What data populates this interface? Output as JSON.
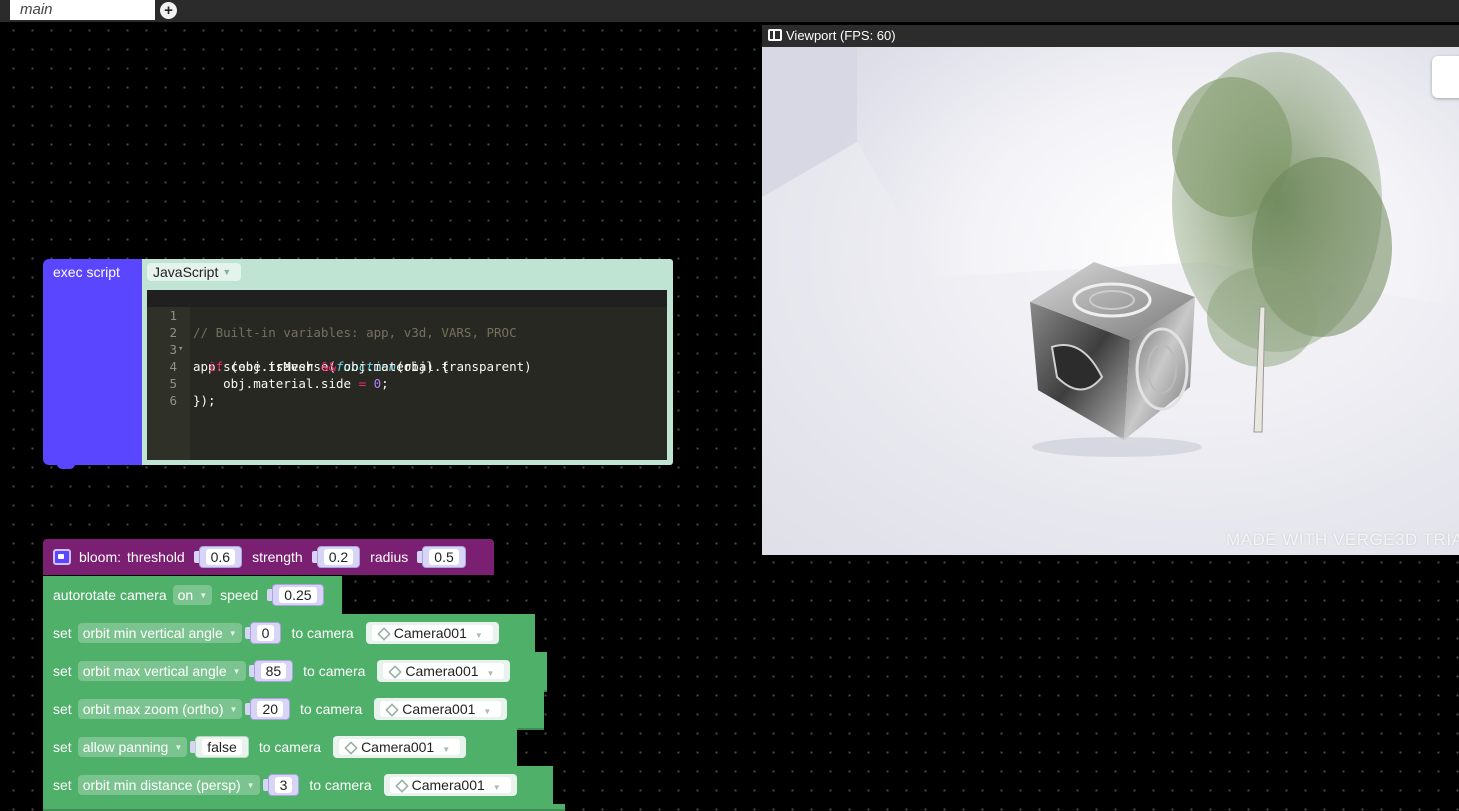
{
  "tab_bar": {
    "tab_label": "main",
    "add_tab_symbol": "+"
  },
  "exec_script": {
    "label": "exec script",
    "language": "JavaScript",
    "code_lines": [
      {
        "num": "1",
        "text": "// Built-in variables: app, v3d, VARS, PROC"
      },
      {
        "num": "2",
        "text": "app.scene.traverse(function(obj) {"
      },
      {
        "num": "3",
        "text": "  if (obj.isMesh && obj.material.transparent)"
      },
      {
        "num": "4",
        "text": "    obj.material.side = 0;"
      },
      {
        "num": "5",
        "text": "});"
      },
      {
        "num": "6",
        "text": ""
      }
    ]
  },
  "viewport": {
    "title": "Viewport (FPS: 60)",
    "watermark": "MADE WITH VERGE3D TRIA"
  },
  "blocks": {
    "bloom": {
      "label": "bloom:",
      "threshold_label": "threshold",
      "threshold": "0.6",
      "strength_label": "strength",
      "strength": "0.2",
      "radius_label": "radius",
      "radius": "0.5"
    },
    "autorotate": {
      "label": "autorotate camera",
      "state": "on",
      "speed_label": "speed",
      "speed": "0.25"
    },
    "set_rows": [
      {
        "set": "set",
        "prop": "orbit min vertical angle",
        "value": "0",
        "to_camera": "to camera",
        "camera": "Camera001"
      },
      {
        "set": "set",
        "prop": "orbit max vertical angle",
        "value": "85",
        "to_camera": "to camera",
        "camera": "Camera001"
      },
      {
        "set": "set",
        "prop": "orbit max zoom (ortho)",
        "value": "20",
        "to_camera": "to camera",
        "camera": "Camera001"
      },
      {
        "set": "set",
        "prop": "allow panning",
        "value": "false",
        "to_camera": "to camera",
        "camera": "Camera001"
      },
      {
        "set": "set",
        "prop": "orbit min distance (persp)",
        "value": "3",
        "to_camera": "to camera",
        "camera": "Camera001"
      }
    ]
  }
}
